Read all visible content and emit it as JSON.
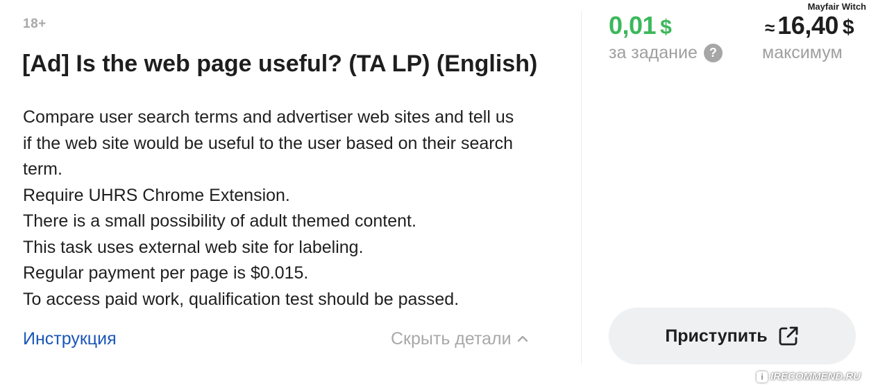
{
  "task": {
    "age_rating": "18+",
    "title": "[Ad] Is the web page useful? (TA LP) (English)",
    "description_lines": [
      "Compare user search terms and advertiser web sites and tell us",
      "if the web site would be useful to the user based on their search",
      "term.",
      "Require UHRS Chrome Extension.",
      "There is a small possibility of adult themed content.",
      "This task uses external web site for labeling.",
      "Regular payment per page is $0.015.",
      "To access paid work, qualification test should be passed."
    ],
    "instruction_link": "Инструкция",
    "hide_details_label": "Скрыть детали"
  },
  "reward": {
    "per_task_value": "0,01",
    "per_task_currency": "$",
    "per_task_caption": "за задание",
    "help_icon_glyph": "?",
    "max_approx_sign": "≈",
    "max_value": "16,40",
    "max_currency": "$",
    "max_caption": "максимум"
  },
  "actions": {
    "start_label": "Приступить",
    "start_icon": "external-link-icon"
  },
  "watermarks": {
    "author": "Mayfair Witch",
    "site": "IRECOMMEND.RU",
    "site_mark": "i"
  },
  "colors": {
    "accent_green": "#3bb85a",
    "link_blue": "#1a56b8",
    "muted_gray": "#a8a8a8",
    "button_bg": "#eff0f2"
  },
  "icons": {
    "collapse": "chevron-up-icon",
    "help": "question-circle-icon"
  }
}
